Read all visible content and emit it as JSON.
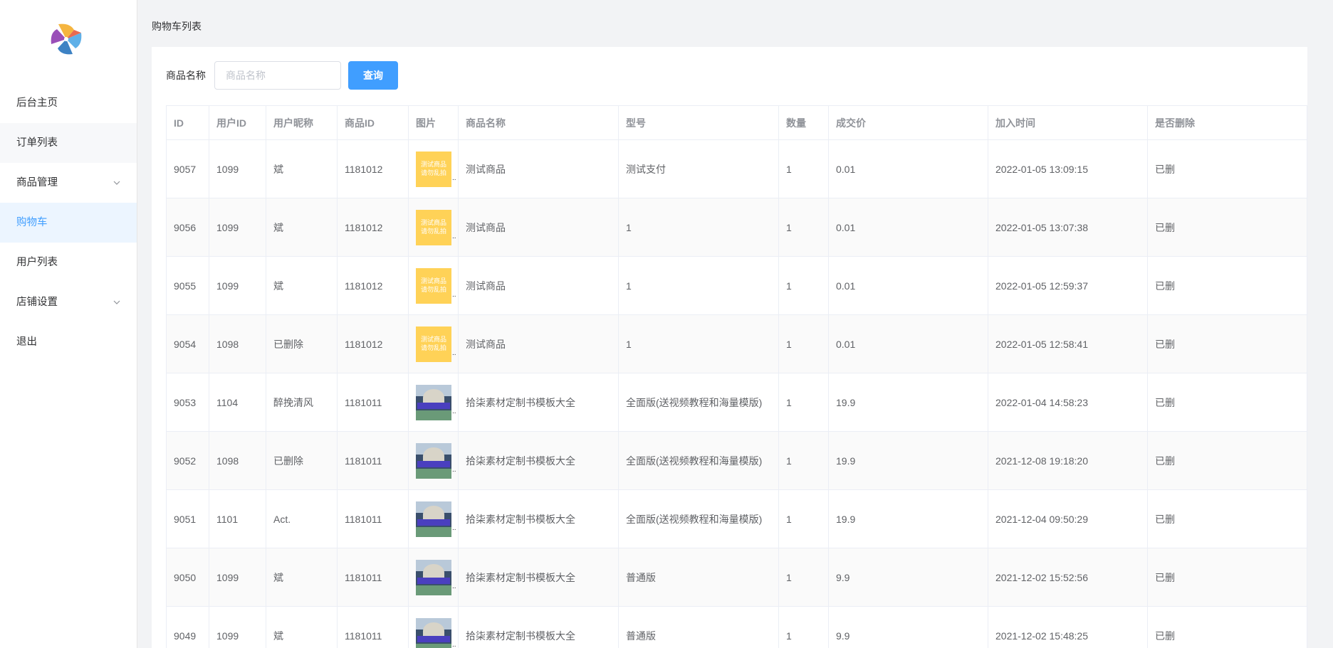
{
  "breadcrumb": "购物车列表",
  "sidebar": {
    "items": [
      {
        "label": "后台主页"
      },
      {
        "label": "订单列表"
      },
      {
        "label": "商品管理"
      },
      {
        "label": "购物车"
      },
      {
        "label": "用户列表"
      },
      {
        "label": "店铺设置"
      },
      {
        "label": "退出"
      }
    ],
    "active_index": 3
  },
  "search": {
    "label": "商品名称",
    "placeholder": "商品名称",
    "value": "",
    "button_label": "查询"
  },
  "table": {
    "columns": [
      "ID",
      "用户ID",
      "用户昵称",
      "商品ID",
      "图片",
      "商品名称",
      "型号",
      "数量",
      "成交价",
      "加入时间",
      "是否删除"
    ],
    "rows": [
      {
        "id": "9057",
        "user_id": "1099",
        "nickname": "斌",
        "goods_id": "1181012",
        "image": "yellow",
        "image_text": "测试商品\n请勿乱拍",
        "goods_name": "测试商品",
        "model": "测试支付",
        "qty": "1",
        "price": "0.01",
        "time": "2022-01-05 13:09:15",
        "deleted": "已删"
      },
      {
        "id": "9056",
        "user_id": "1099",
        "nickname": "斌",
        "goods_id": "1181012",
        "image": "yellow",
        "image_text": "测试商品\n请勿乱拍",
        "goods_name": "测试商品",
        "model": "1",
        "qty": "1",
        "price": "0.01",
        "time": "2022-01-05 13:07:38",
        "deleted": "已删"
      },
      {
        "id": "9055",
        "user_id": "1099",
        "nickname": "斌",
        "goods_id": "1181012",
        "image": "yellow",
        "image_text": "测试商品\n请勿乱拍",
        "goods_name": "测试商品",
        "model": "1",
        "qty": "1",
        "price": "0.01",
        "time": "2022-01-05 12:59:37",
        "deleted": "已删"
      },
      {
        "id": "9054",
        "user_id": "1098",
        "nickname": "已删除",
        "goods_id": "1181012",
        "image": "yellow",
        "image_text": "测试商品\n请勿乱拍",
        "goods_name": "测试商品",
        "model": "1",
        "qty": "1",
        "price": "0.01",
        "time": "2022-01-05 12:58:41",
        "deleted": "已删"
      },
      {
        "id": "9053",
        "user_id": "1104",
        "nickname": "醉挽清风",
        "goods_id": "1181011",
        "image": "poster",
        "image_text": "",
        "goods_name": "拾柒素材定制书模板大全",
        "model": "全面版(送视频教程和海量模版)",
        "qty": "1",
        "price": "19.9",
        "time": "2022-01-04 14:58:23",
        "deleted": "已删"
      },
      {
        "id": "9052",
        "user_id": "1098",
        "nickname": "已删除",
        "goods_id": "1181011",
        "image": "poster",
        "image_text": "",
        "goods_name": "拾柒素材定制书模板大全",
        "model": "全面版(送视频教程和海量模版)",
        "qty": "1",
        "price": "19.9",
        "time": "2021-12-08 19:18:20",
        "deleted": "已删"
      },
      {
        "id": "9051",
        "user_id": "1101",
        "nickname": "Act.",
        "goods_id": "1181011",
        "image": "poster",
        "image_text": "",
        "goods_name": "拾柒素材定制书模板大全",
        "model": "全面版(送视频教程和海量模版)",
        "qty": "1",
        "price": "19.9",
        "time": "2021-12-04 09:50:29",
        "deleted": "已删"
      },
      {
        "id": "9050",
        "user_id": "1099",
        "nickname": "斌",
        "goods_id": "1181011",
        "image": "poster",
        "image_text": "",
        "goods_name": "拾柒素材定制书模板大全",
        "model": "普通版",
        "qty": "1",
        "price": "9.9",
        "time": "2021-12-02 15:52:56",
        "deleted": "已删"
      },
      {
        "id": "9049",
        "user_id": "1099",
        "nickname": "斌",
        "goods_id": "1181011",
        "image": "poster",
        "image_text": "",
        "goods_name": "拾柒素材定制书模板大全",
        "model": "普通版",
        "qty": "1",
        "price": "9.9",
        "time": "2021-12-02 15:48:25",
        "deleted": "已删"
      }
    ]
  },
  "colors": {
    "accent": "#409eff",
    "active_bg": "#ecf5ff",
    "page_bg": "#f2f3f5",
    "thumb_yellow": "#ffd257"
  }
}
